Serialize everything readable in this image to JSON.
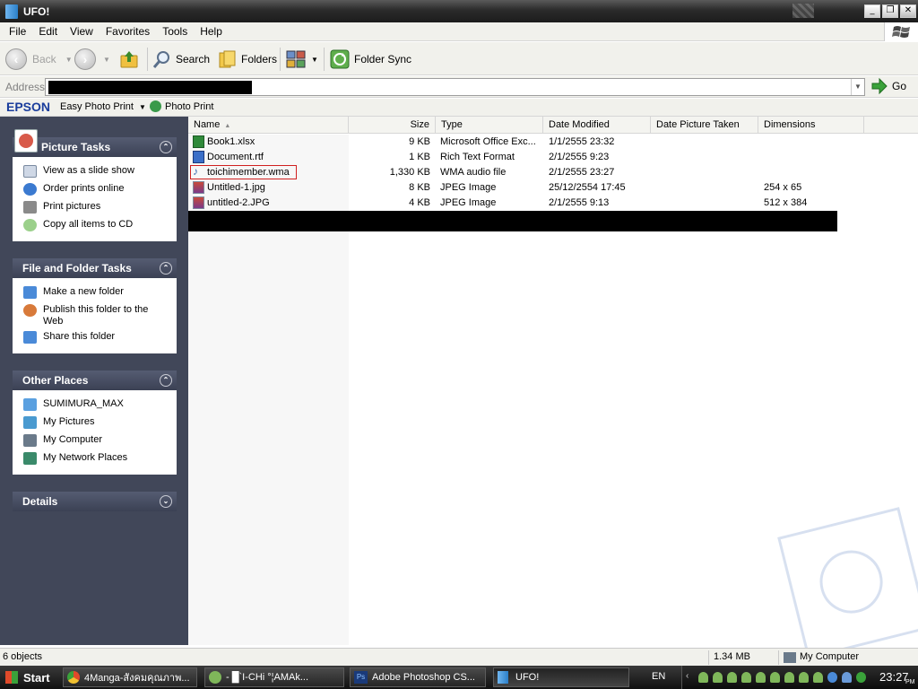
{
  "window": {
    "title": "UFO!"
  },
  "menubar": {
    "items": [
      "File",
      "Edit",
      "View",
      "Favorites",
      "Tools",
      "Help"
    ]
  },
  "toolbar": {
    "back_label": "Back",
    "search_label": "Search",
    "folders_label": "Folders",
    "folder_sync_label": "Folder Sync"
  },
  "address": {
    "label": "Address",
    "go_label": "Go"
  },
  "epson": {
    "brand": "EPSON",
    "easy_photo_print": "Easy Photo Print",
    "photo_print": "Photo Print"
  },
  "panels": {
    "picture_tasks": {
      "title": "Picture Tasks",
      "items": [
        "View as a slide show",
        "Order prints online",
        "Print pictures",
        "Copy all items to CD"
      ]
    },
    "file_folder_tasks": {
      "title": "File and Folder Tasks",
      "items": [
        "Make a new folder",
        "Publish this folder to the Web",
        "Share this folder"
      ]
    },
    "other_places": {
      "title": "Other Places",
      "items": [
        "SUMIMURA_MAX",
        "My Pictures",
        "My Computer",
        "My Network Places"
      ]
    },
    "details": {
      "title": "Details"
    }
  },
  "columns": {
    "name": "Name",
    "size": "Size",
    "type": "Type",
    "date_modified": "Date Modified",
    "date_picture_taken": "Date Picture Taken",
    "dimensions": "Dimensions"
  },
  "files": [
    {
      "name": "Book1.xlsx",
      "size": "9 KB",
      "type": "Microsoft Office Exc...",
      "modified": "1/1/2555 23:32",
      "dimensions": "",
      "icon": "excel-file-icon"
    },
    {
      "name": "Document.rtf",
      "size": "1 KB",
      "type": "Rich Text Format",
      "modified": "2/1/2555 9:23",
      "dimensions": "",
      "icon": "word-file-icon"
    },
    {
      "name": "toichimember.wma",
      "size": "1,330 KB",
      "type": "WMA audio file",
      "modified": "2/1/2555 23:27",
      "dimensions": "",
      "icon": "audio-file-icon"
    },
    {
      "name": "Untitled-1.jpg",
      "size": "8 KB",
      "type": "JPEG Image",
      "modified": "25/12/2554 17:45",
      "dimensions": "254 x 65",
      "icon": "image-file-icon"
    },
    {
      "name": "untitled-2.JPG",
      "size": "4 KB",
      "type": "JPEG Image",
      "modified": "2/1/2555 9:13",
      "dimensions": "512 x 384",
      "icon": "image-file-icon"
    }
  ],
  "statusbar": {
    "objects": "6 objects",
    "size": "1.34 MB",
    "location": "My Computer"
  },
  "taskbar": {
    "start_label": "Start",
    "buttons": [
      "4Manga-สังคมคุณภาพ...",
      "- █`I-CHi °¦AMAk...",
      "Adobe Photoshop CS...",
      "UFO!"
    ],
    "lang": "EN",
    "clock": "23:27",
    "clock_suffix": "PM"
  },
  "colors": {
    "panel_header": "#414759",
    "selection_outline": "#e02020",
    "epson_blue": "#1a3d9c"
  }
}
